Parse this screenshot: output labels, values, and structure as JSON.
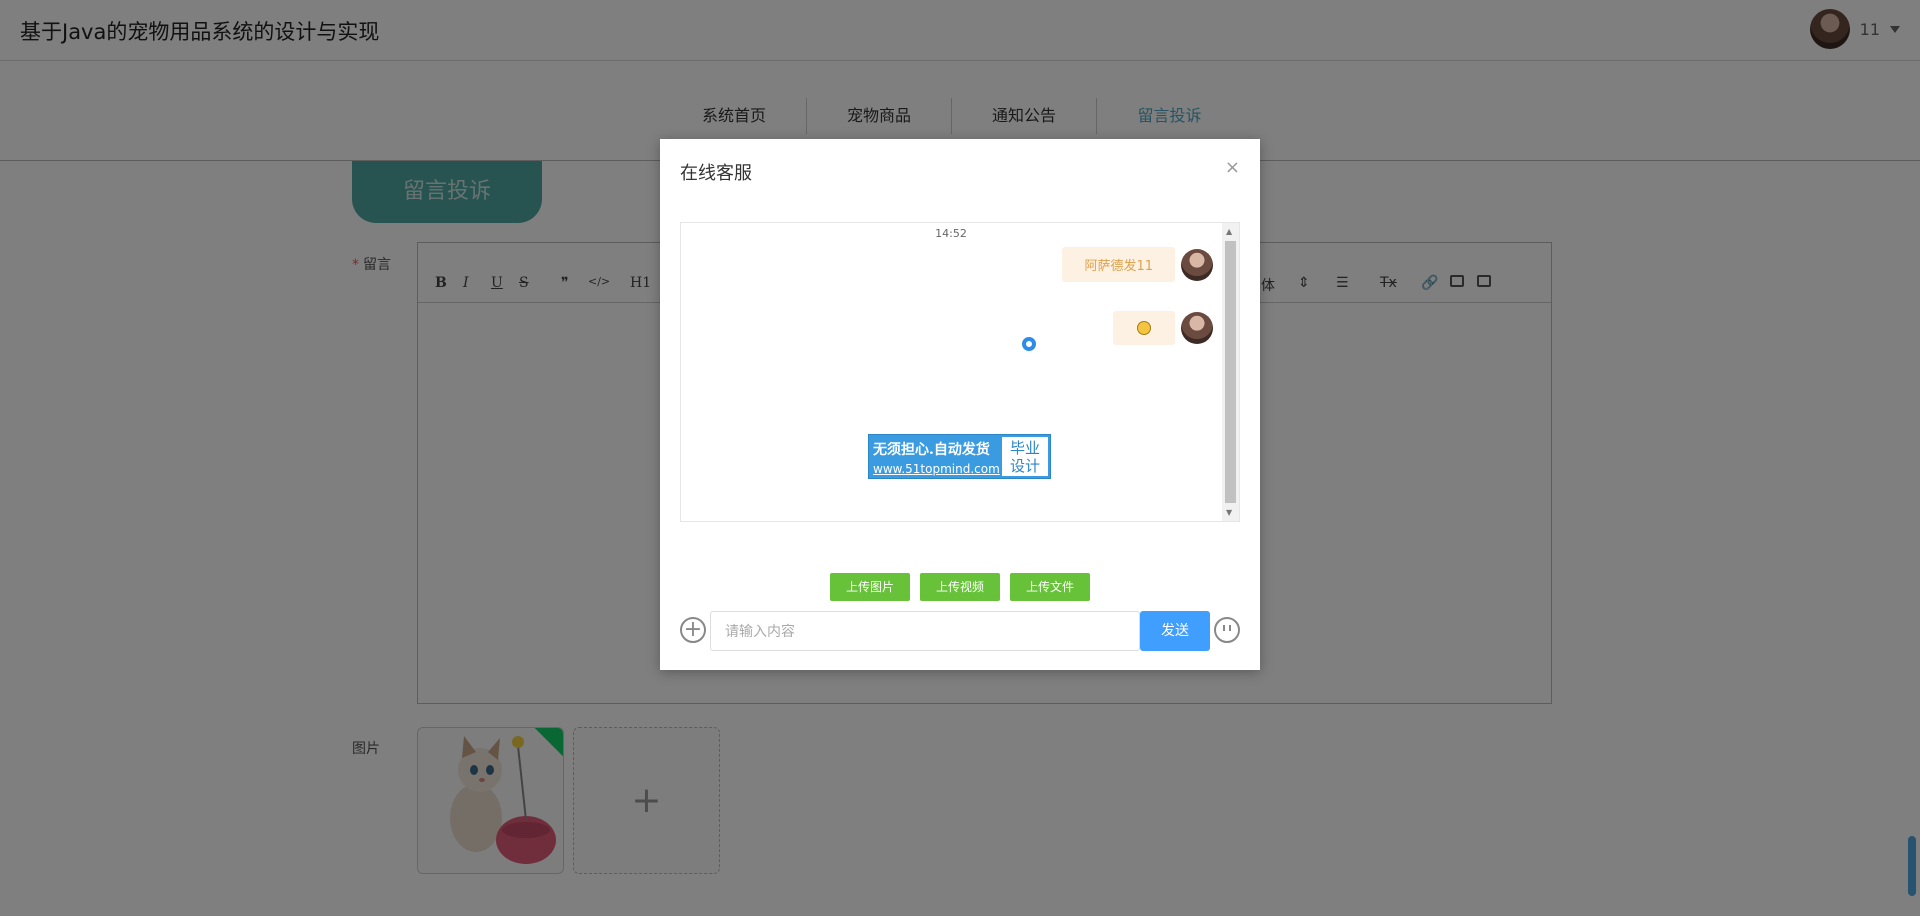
{
  "header": {
    "site_title": "基于Java的宠物用品系统的设计与实现",
    "user_name": "11"
  },
  "nav": {
    "items": [
      "系统首页",
      "宠物商品",
      "通知公告",
      "留言投诉"
    ],
    "active_index": 3
  },
  "page": {
    "section_tab": "留言投诉",
    "message_label": "留言",
    "message_required_mark": "*",
    "image_label": "图片",
    "add_image_symbol": "+"
  },
  "editor": {
    "toolbar_buttons": [
      "B",
      "I",
      "U",
      "S",
      "❞",
      "</>",
      "H1"
    ],
    "font_label": "体",
    "clear_format": "Tx"
  },
  "dialog": {
    "title": "在线客服",
    "close_symbol": "×",
    "chat_time": "14:52",
    "messages": [
      {
        "type": "text",
        "text": "阿萨德发11"
      },
      {
        "type": "emoji",
        "icon": "grinning-emoji"
      }
    ],
    "upload_buttons": [
      "上传图片",
      "上传视频",
      "上传文件"
    ],
    "input_placeholder": "请输入内容",
    "send_label": "发送"
  },
  "watermark": {
    "main": "无须担心.自动发货",
    "url": "www.51topmind.com",
    "side_line1": "毕业",
    "side_line2": "设计"
  },
  "colors": {
    "accent_teal": "#4fa7a0",
    "nav_active": "#4ea7c5",
    "send_button": "#409eff",
    "upload_button": "#67c23a"
  }
}
